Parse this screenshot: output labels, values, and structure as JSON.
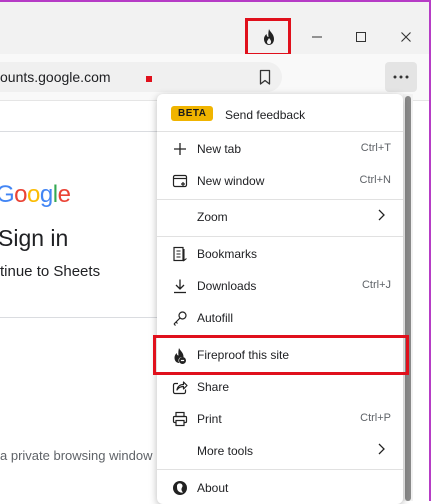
{
  "addressbar": {
    "url": "ounts.google.com"
  },
  "page": {
    "logo_letters": [
      "G",
      "o",
      "o",
      "g",
      "l",
      "e"
    ],
    "logo_colors": [
      "#4285F4",
      "#EA4335",
      "#FBBC05",
      "#4285F4",
      "#34A853",
      "#EA4335"
    ],
    "heading": "Sign in",
    "subheading": "tinue to Sheets",
    "private_notice": "a private browsing window"
  },
  "menu": {
    "beta_badge": "BETA",
    "feedback": "Send feedback",
    "items": {
      "new_tab": {
        "label": "New tab",
        "shortcut": "Ctrl+T"
      },
      "new_window": {
        "label": "New window",
        "shortcut": "Ctrl+N"
      },
      "zoom": {
        "label": "Zoom"
      },
      "bookmarks": {
        "label": "Bookmarks"
      },
      "downloads": {
        "label": "Downloads",
        "shortcut": "Ctrl+J"
      },
      "autofill": {
        "label": "Autofill"
      },
      "fireproof": {
        "label": "Fireproof this site"
      },
      "share": {
        "label": "Share"
      },
      "print": {
        "label": "Print",
        "shortcut": "Ctrl+P"
      },
      "more_tools": {
        "label": "More tools"
      },
      "about": {
        "label": "About"
      }
    }
  },
  "colors": {
    "highlight": "#e0101c",
    "beta": "#f0b400",
    "frame": "#b63cc6"
  },
  "icons": [
    "fire-icon",
    "minimize-icon",
    "maximize-icon",
    "close-icon",
    "bookmark-icon",
    "more-icon",
    "plus-icon",
    "new-window-icon",
    "chevron-right-icon",
    "bookmarks-icon",
    "download-icon",
    "key-icon",
    "fireproof-icon",
    "share-icon",
    "printer-icon",
    "about-icon"
  ]
}
